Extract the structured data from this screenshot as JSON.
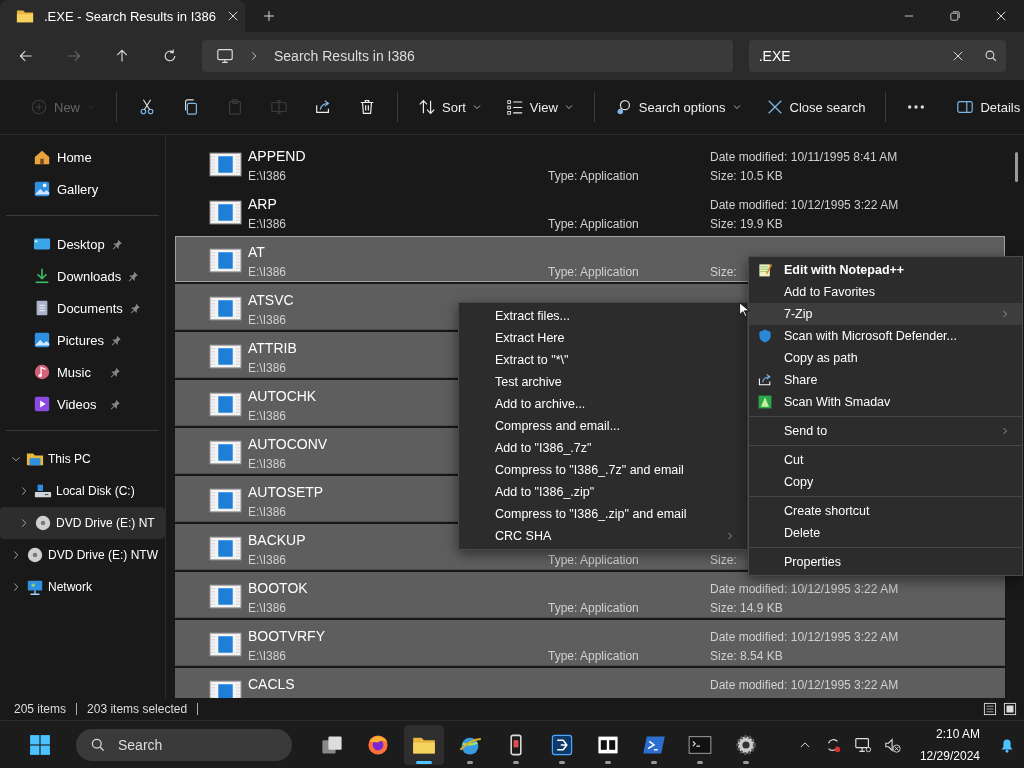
{
  "window": {
    "tab_title": ".EXE - Search Results in I386"
  },
  "navigation_buttons": [
    {
      "disabled": false
    },
    {
      "disabled": true
    },
    {
      "disabled": false
    },
    {
      "disabled": false
    }
  ],
  "address": {
    "path": "Search Results in I386"
  },
  "search": {
    "value": ".EXE"
  },
  "toolbar": {
    "groups": [
      {
        "items": [
          {
            "label": "New",
            "disabled": true,
            "dropdown": true
          }
        ]
      },
      {
        "items": [
          {
            "disabled": false,
            "dropdown": false
          },
          {
            "disabled": false,
            "dropdown": false
          },
          {
            "disabled": true,
            "dropdown": false
          },
          {
            "disabled": true,
            "dropdown": false
          },
          {
            "disabled": false,
            "dropdown": false
          },
          {
            "disabled": false,
            "dropdown": false
          }
        ]
      },
      {
        "items": [
          {
            "label": "Sort",
            "disabled": false,
            "dropdown": true
          },
          {
            "label": "View",
            "disabled": false,
            "dropdown": true
          }
        ]
      },
      {
        "items": [
          {
            "label": "Search options",
            "disabled": false,
            "dropdown": true
          },
          {
            "label": "Close search",
            "disabled": false,
            "dropdown": false
          }
        ]
      },
      {
        "items": [
          {
            "disabled": false,
            "dropdown": false
          }
        ]
      }
    ],
    "details": {
      "label": "Details"
    }
  },
  "sidebar": {
    "sections": [
      {
        "items": [
          {
            "label": "Home",
            "pinned": false
          },
          {
            "label": "Gallery",
            "pinned": false
          }
        ]
      },
      {
        "items": [
          {
            "label": "Desktop",
            "pinned": true
          },
          {
            "label": "Downloads",
            "pinned": true
          },
          {
            "label": "Documents",
            "pinned": true
          },
          {
            "label": "Pictures",
            "pinned": true
          },
          {
            "label": "Music",
            "pinned": true
          },
          {
            "label": "Videos",
            "pinned": true
          }
        ]
      }
    ],
    "tree": [
      {
        "label": "This PC",
        "expanded": true,
        "selected": false,
        "children": [
          {
            "label": "Local Disk (C:)",
            "expanded": false,
            "selected": false
          },
          {
            "label": "DVD Drive (E:) NT",
            "expanded": false,
            "selected": true
          }
        ]
      },
      {
        "label": "DVD Drive (E:) NTW",
        "expanded": false,
        "selected": false
      },
      {
        "label": "Network",
        "expanded": false,
        "selected": false
      }
    ]
  },
  "files": [
    {
      "name": "APPEND",
      "path": "E:\\I386",
      "type": "Type: Application",
      "date": "Date modified: 10/11/1995 8:41 AM",
      "size": "Size: 10.5 KB",
      "selected": false,
      "focused": false
    },
    {
      "name": "ARP",
      "path": "E:\\I386",
      "type": "Type: Application",
      "date": "Date modified: 10/12/1995 3:22 AM",
      "size": "Size: 19.9 KB",
      "selected": false,
      "focused": false
    },
    {
      "name": "AT",
      "path": "E:\\I386",
      "type": "Type: Application",
      "size": "Size:",
      "selected": true,
      "focused": true
    },
    {
      "name": "ATSVC",
      "path": "E:\\I386",
      "selected": true,
      "focused": false
    },
    {
      "name": "ATTRIB",
      "path": "E:\\I386",
      "selected": true,
      "focused": false
    },
    {
      "name": "AUTOCHK",
      "path": "E:\\I386",
      "selected": true,
      "focused": false
    },
    {
      "name": "AUTOCONV",
      "path": "E:\\I386",
      "selected": true,
      "focused": false
    },
    {
      "name": "AUTOSETP",
      "path": "E:\\I386",
      "selected": true,
      "focused": false
    },
    {
      "name": "BACKUP",
      "path": "E:\\I386",
      "type": "Type: Application",
      "size": "Size:",
      "selected": true,
      "focused": false
    },
    {
      "name": "BOOTOK",
      "path": "E:\\I386",
      "type": "Type: Application",
      "date": "Date modified: 10/12/1995 3:22 AM",
      "size": "Size: 14.9 KB",
      "selected": true,
      "focused": false
    },
    {
      "name": "BOOTVRFY",
      "path": "E:\\I386",
      "type": "Type: Application",
      "date": "Date modified: 10/12/1995 3:22 AM",
      "size": "Size: 8.54 KB",
      "selected": true,
      "focused": false
    },
    {
      "name": "CACLS",
      "date": "Date modified: 10/12/1995 3:22 AM",
      "selected": true,
      "focused": false
    }
  ],
  "zip_submenu": {
    "items": [
      {
        "label": "Extract files...",
        "submenu": false,
        "highlighted": false
      },
      {
        "label": "Extract Here",
        "submenu": false,
        "highlighted": false
      },
      {
        "label": "Extract to \"*\\\"",
        "submenu": false,
        "highlighted": false
      },
      {
        "label": "Test archive",
        "submenu": false,
        "highlighted": false
      },
      {
        "label": "Add to archive...",
        "submenu": false,
        "highlighted": false
      },
      {
        "label": "Compress and email...",
        "submenu": false,
        "highlighted": false
      },
      {
        "label": "Add to \"I386_.7z\"",
        "submenu": false,
        "highlighted": false
      },
      {
        "label": "Compress to \"I386_.7z\" and email",
        "submenu": false,
        "highlighted": false
      },
      {
        "label": "Add to \"I386_.zip\"",
        "submenu": false,
        "highlighted": false
      },
      {
        "label": "Compress to \"I386_.zip\" and email",
        "submenu": false,
        "highlighted": false
      },
      {
        "label": "CRC SHA",
        "submenu": true,
        "highlighted": false
      }
    ]
  },
  "context_menu": {
    "groups": [
      {
        "items": [
          {
            "label": "Edit with Notepad++",
            "default": true,
            "submenu": false,
            "highlighted": false
          },
          {
            "label": "Add to Favorites",
            "default": false,
            "submenu": false,
            "highlighted": false
          },
          {
            "label": "7-Zip",
            "default": false,
            "submenu": true,
            "highlighted": true
          },
          {
            "label": "Scan with Microsoft Defender...",
            "default": false,
            "submenu": false,
            "highlighted": false
          },
          {
            "label": "Copy as path",
            "default": false,
            "submenu": false,
            "highlighted": false
          },
          {
            "label": "Share",
            "default": false,
            "submenu": false,
            "highlighted": false
          },
          {
            "label": "Scan With Smadav",
            "default": false,
            "submenu": false,
            "highlighted": false
          }
        ]
      },
      {
        "items": [
          {
            "label": "Send to",
            "default": false,
            "submenu": true,
            "highlighted": false
          }
        ]
      },
      {
        "items": [
          {
            "label": "Cut",
            "default": false,
            "submenu": false,
            "highlighted": false
          },
          {
            "label": "Copy",
            "default": false,
            "submenu": false,
            "highlighted": false
          }
        ]
      },
      {
        "items": [
          {
            "label": "Create shortcut",
            "default": false,
            "submenu": false,
            "highlighted": false
          },
          {
            "label": "Delete",
            "default": false,
            "submenu": false,
            "highlighted": false
          }
        ]
      },
      {
        "items": [
          {
            "label": "Properties",
            "default": false,
            "submenu": false,
            "highlighted": false
          }
        ]
      }
    ]
  },
  "status_bar": {
    "item_count": "205 items",
    "selection": "203 items selected"
  },
  "taskbar": {
    "search_placeholder": "Search",
    "apps": [
      {
        "running": false,
        "active": false
      },
      {
        "running": false,
        "active": false
      },
      {
        "running": true,
        "active": true
      },
      {
        "running": true,
        "active": false
      },
      {
        "running": true,
        "active": false
      },
      {
        "running": true,
        "active": false
      },
      {
        "running": true,
        "active": false
      },
      {
        "running": true,
        "active": false
      },
      {
        "running": true,
        "active": false
      },
      {
        "running": true,
        "active": false
      }
    ],
    "time": "2:10 AM",
    "date": "12/29/2024"
  }
}
